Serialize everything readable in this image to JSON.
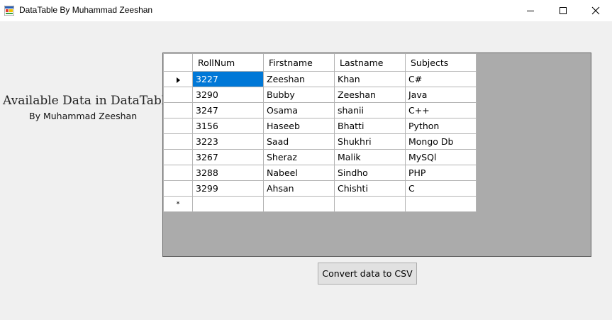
{
  "window": {
    "title": "DataTable By Muhammad Zeeshan"
  },
  "main": {
    "heading": "Available Data in DataTable",
    "subheading": "By Muhammad Zeeshan",
    "convert_button_label": "Convert data to CSV"
  },
  "grid": {
    "columns": [
      "RollNum",
      "Firstname",
      "Lastname",
      "Subjects"
    ],
    "rows": [
      [
        "3227",
        "Zeeshan",
        "Khan",
        "C#"
      ],
      [
        "3290",
        "Bubby",
        "Zeeshan",
        "Java"
      ],
      [
        "3247",
        "Osama",
        "shanii",
        "C++"
      ],
      [
        "3156",
        "Haseeb",
        "Bhatti",
        "Python"
      ],
      [
        "3223",
        "Saad",
        "Shukhri",
        "Mongo Db"
      ],
      [
        "3267",
        "Sheraz",
        "Malik",
        "MySQl"
      ],
      [
        "3288",
        "Nabeel",
        "Sindho",
        "PHP"
      ],
      [
        "3299",
        "Ahsan",
        "Chishti",
        "C"
      ]
    ],
    "new_row_marker": "*",
    "selected_cell": "3227"
  },
  "colors": {
    "selection": "#0078d7",
    "grid_background": "#ababab",
    "window_background": "#f0f0f0"
  }
}
